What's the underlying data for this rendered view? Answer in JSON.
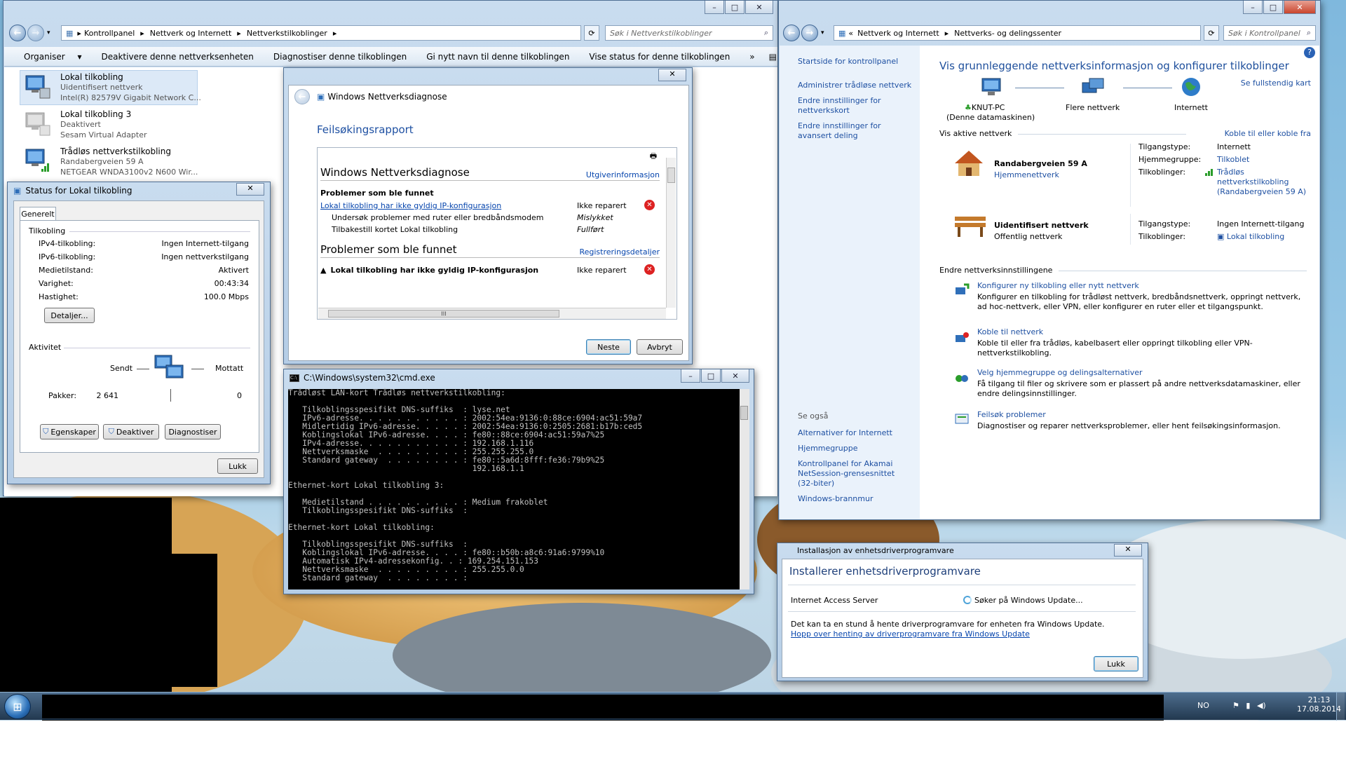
{
  "explorer": {
    "address": [
      "Kontrollpanel",
      "Nettverk og Internett",
      "Nettverkstilkoblinger"
    ],
    "search_placeholder": "Søk i Nettverkstilkoblinger",
    "toolbar": [
      "Organiser",
      "Deaktivere denne nettverksenheten",
      "Diagnostiser denne tilkoblingen",
      "Gi nytt navn til denne tilkoblingen",
      "Vise status for denne tilkoblingen",
      "»"
    ],
    "connections": [
      {
        "name": "Lokal tilkobling",
        "status": "Uidentifisert nettverk",
        "adapter": "Intel(R) 82579V Gigabit Network C..."
      },
      {
        "name": "Lokal tilkobling 3",
        "status": "Deaktivert",
        "adapter": "Sesam Virtual Adapter"
      },
      {
        "name": "Trådløs nettverkstilkobling",
        "status": "Randabergveien 59 A",
        "adapter": "NETGEAR WNDA3100v2 N600 Wir..."
      }
    ]
  },
  "status_dialog": {
    "title": "Status for Lokal tilkobling",
    "tab": "Generelt",
    "section_connection": "Tilkobling",
    "rows": [
      {
        "label": "IPv4-tilkobling:",
        "value": "Ingen Internett-tilgang"
      },
      {
        "label": "IPv6-tilkobling:",
        "value": "Ingen nettverkstilgang"
      },
      {
        "label": "Medietilstand:",
        "value": "Aktivert"
      },
      {
        "label": "Varighet:",
        "value": "00:43:34"
      },
      {
        "label": "Hastighet:",
        "value": "100.0 Mbps"
      }
    ],
    "details_button": "Detaljer...",
    "section_activity": "Aktivitet",
    "sent_label": "Sendt",
    "received_label": "Mottatt",
    "packets_label": "Pakker:",
    "packets_sent": "2 641",
    "packets_received": "0",
    "buttons": [
      "Egenskaper",
      "Deaktiver",
      "Diagnostiser"
    ],
    "close_button": "Lukk"
  },
  "diag_dialog": {
    "title": "Windows Nettverksdiagnose",
    "report_heading": "Feilsøkingsrapport",
    "inner_title": "Windows Nettverksdiagnose",
    "publisher_link": "Utgiverinformasjon",
    "problems_found": "Problemer som ble funnet",
    "problem_link": "Lokal tilkobling har ikke gyldig IP-konfigurasjon",
    "problem_status": "Ikke reparert",
    "steps": [
      {
        "text": "Undersøk problemer med ruter eller bredbåndsmodem",
        "status": "Mislykket"
      },
      {
        "text": "Tilbakestill kortet Lokal tilkobling",
        "status": "Fullført"
      }
    ],
    "problems_found_2": "Problemer som ble funnet",
    "registration_link": "Registreringsdetaljer",
    "problem_2": "Lokal tilkobling har ikke gyldig IP-konfigurasjon",
    "problem_2_status": "Ikke reparert",
    "next_button": "Neste",
    "cancel_button": "Avbryt"
  },
  "cmd": {
    "title": "C:\\Windows\\system32\\cmd.exe",
    "lines": [
      "Trådløst LAN-kort Trådløs nettverkstilkobling:",
      "",
      "   Tilkoblingsspesifikt DNS-suffiks  : lyse.net",
      "   IPv6-adresse. . . . . . . . . . . : 2002:54ea:9136:0:88ce:6904:ac51:59a7",
      "   Midlertidig IPv6-adresse. . . . . : 2002:54ea:9136:0:2505:2681:b17b:ced5",
      "   Koblingslokal IPv6-adresse. . . . : fe80::88ce:6904:ac51:59a7%25",
      "   IPv4-adresse. . . . . . . . . . . : 192.168.1.116",
      "   Nettverksmaske  . . . . . . . . . : 255.255.255.0",
      "   Standard gateway  . . . . . . . . : fe80::5a6d:8fff:fe36:79b9%25",
      "                                       192.168.1.1",
      "",
      "Ethernet-kort Lokal tilkobling 3:",
      "",
      "   Medietilstand . . . . . . . . . . : Medium frakoblet",
      "   Tilkoblingsspesifikt DNS-suffiks  :",
      "",
      "Ethernet-kort Lokal tilkobling:",
      "",
      "   Tilkoblingsspesifikt DNS-suffiks  :",
      "   Koblingslokal IPv6-adresse. . . . : fe80::b50b:a8c6:91a6:9799%10",
      "   Automatisk IPv4-adressekonfig. . : 169.254.151.153",
      "   Nettverksmaske  . . . . . . . . . : 255.255.0.0",
      "   Standard gateway  . . . . . . . . :"
    ]
  },
  "network_center": {
    "address": [
      "Nettverk og Internett",
      "Nettverks- og delingssenter"
    ],
    "search_placeholder": "Søk i Kontrollpanel",
    "sidebar_links": [
      "Startside for kontrollpanel",
      "Administrer trådløse nettverk",
      "Endre innstillinger for nettverkskort",
      "Endre innstillinger for avansert deling"
    ],
    "see_also": "Se også",
    "see_also_links": [
      "Alternativer for Internett",
      "Hjemmegruppe",
      "Kontrollpanel for Akamai NetSession-grensesnittet (32-biter)",
      "Windows-brannmur"
    ],
    "heading": "Vis grunnleggende nettverksinformasjon og konfigurer tilkoblinger",
    "full_map_link": "Se fullstendig kart",
    "map": [
      {
        "label": "KNUT-PC",
        "sub": "(Denne datamaskinen)"
      },
      {
        "label": "Flere nettverk",
        "sub": ""
      },
      {
        "label": "Internett",
        "sub": ""
      }
    ],
    "active_networks_label": "Vis aktive nettverk",
    "connect_link": "Koble til eller koble fra",
    "networks": [
      {
        "name": "Randabergveien 59 A",
        "type": "Hjemmenettverk",
        "access_label": "Tilgangstype:",
        "access": "Internett",
        "homegroup_label": "Hjemmegruppe:",
        "homegroup": "Tilkoblet",
        "conn_label": "Tilkoblinger:",
        "conn": "Trådløs nettverkstilkobling (Randabergveien 59 A)"
      },
      {
        "name": "Uidentifisert nettverk",
        "type": "Offentlig nettverk",
        "access_label": "Tilgangstype:",
        "access": "Ingen Internett-tilgang",
        "conn_label": "Tilkoblinger:",
        "conn": "Lokal tilkobling"
      }
    ],
    "change_settings_label": "Endre nettverksinnstillingene",
    "tasks": [
      {
        "title": "Konfigurer ny tilkobling eller nytt nettverk",
        "desc": "Konfigurer en tilkobling for trådløst nettverk, bredbåndsnettverk, oppringt nettverk, ad hoc-nettverk, eller VPN, eller konfigurer en ruter eller et tilgangspunkt."
      },
      {
        "title": "Koble til nettverk",
        "desc": "Koble til eller fra trådløs, kabelbasert eller oppringt tilkobling eller VPN-nettverkstilkobling."
      },
      {
        "title": "Velg hjemmegruppe og delingsalternativer",
        "desc": "Få tilgang til filer og skrivere som er plassert på andre nettverksdatamaskiner, eller endre delingsinnstillinger."
      },
      {
        "title": "Feilsøk problemer",
        "desc": "Diagnostiser og reparer nettverksproblemer, eller hent feilsøkingsinformasjon."
      }
    ]
  },
  "driver_dialog": {
    "title": "Installasjon av enhetsdriverprogramvare",
    "heading": "Installerer enhetsdriverprogramvare",
    "device": "Internet Access Server",
    "status": "Søker på Windows Update...",
    "info": "Det kan ta en stund å hente driverprogramvare for enheten fra Windows Update.",
    "skip_link": "Hopp over henting av driverprogramvare fra Windows Update",
    "close_button": "Lukk"
  },
  "taskbar": {
    "language": "NO",
    "time": "21:13",
    "date": "17.08.2014"
  },
  "colors": {
    "link": "#1e50a2",
    "nc_sidebar": "#eaf2fb",
    "cmd_bg": "#000000",
    "error_red": "#d22222"
  }
}
